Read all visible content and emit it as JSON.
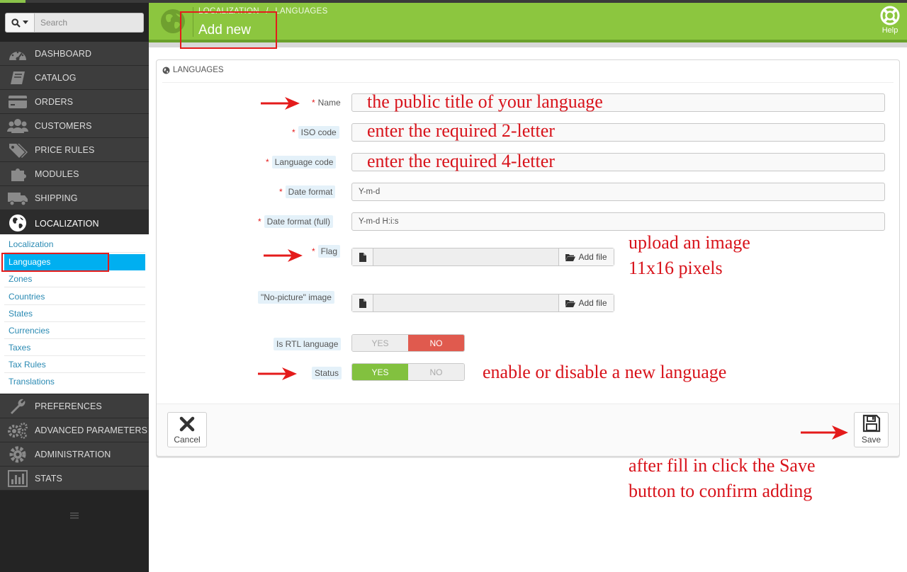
{
  "sidebar": {
    "search_placeholder": "Search",
    "menu": [
      {
        "label": "DASHBOARD",
        "icon": "dashboard-icon"
      },
      {
        "label": "CATALOG",
        "icon": "book-icon"
      },
      {
        "label": "ORDERS",
        "icon": "credit-card-icon"
      },
      {
        "label": "CUSTOMERS",
        "icon": "users-icon"
      },
      {
        "label": "PRICE RULES",
        "icon": "tags-icon"
      },
      {
        "label": "MODULES",
        "icon": "puzzle-icon"
      },
      {
        "label": "SHIPPING",
        "icon": "truck-icon"
      },
      {
        "label": "LOCALIZATION",
        "icon": "globe-icon"
      },
      {
        "label": "PREFERENCES",
        "icon": "wrench-icon"
      },
      {
        "label": "ADVANCED PARAMETERS",
        "icon": "cogs-icon"
      },
      {
        "label": "ADMINISTRATION",
        "icon": "cog-icon"
      },
      {
        "label": "STATS",
        "icon": "bar-chart-icon"
      }
    ],
    "submenu": [
      "Localization",
      "Languages",
      "Zones",
      "Countries",
      "States",
      "Currencies",
      "Taxes",
      "Tax Rules",
      "Translations"
    ],
    "selected_submenu": "Languages"
  },
  "header": {
    "breadcrumb_parent": "LOCALIZATION",
    "breadcrumb_sep": "/",
    "breadcrumb_current": "LANGUAGES",
    "title": "Add new",
    "help_label": "Help",
    "accent_color": "#8cc63f"
  },
  "panel": {
    "heading": "LANGUAGES",
    "fields": {
      "name": {
        "label": "Name",
        "value": ""
      },
      "iso": {
        "label": "ISO code",
        "value": ""
      },
      "lang_code": {
        "label": "Language code",
        "value": ""
      },
      "date_format": {
        "label": "Date format",
        "value": "Y-m-d"
      },
      "date_format_full": {
        "label": "Date format (full)",
        "value": "Y-m-d H:i:s"
      },
      "flag": {
        "label": "Flag",
        "button": "Add file"
      },
      "no_picture": {
        "label": "\"No-picture\" image",
        "button": "Add file"
      },
      "rtl": {
        "label": "Is RTL language",
        "yes": "YES",
        "no": "NO",
        "value": "NO"
      },
      "status": {
        "label": "Status",
        "yes": "YES",
        "no": "NO",
        "value": "YES"
      }
    },
    "required_mark": "*",
    "cancel_label": "Cancel",
    "save_label": "Save"
  },
  "annotations": {
    "name": "the public title of your language",
    "iso": "enter the required 2-letter",
    "lang_code": "enter the required 4-letter",
    "flag_line1": "upload an image",
    "flag_line2": "11x16 pixels",
    "status": "enable or disable a new language",
    "save_line1": "after fill in click the Save",
    "save_line2": "button to confirm adding"
  }
}
